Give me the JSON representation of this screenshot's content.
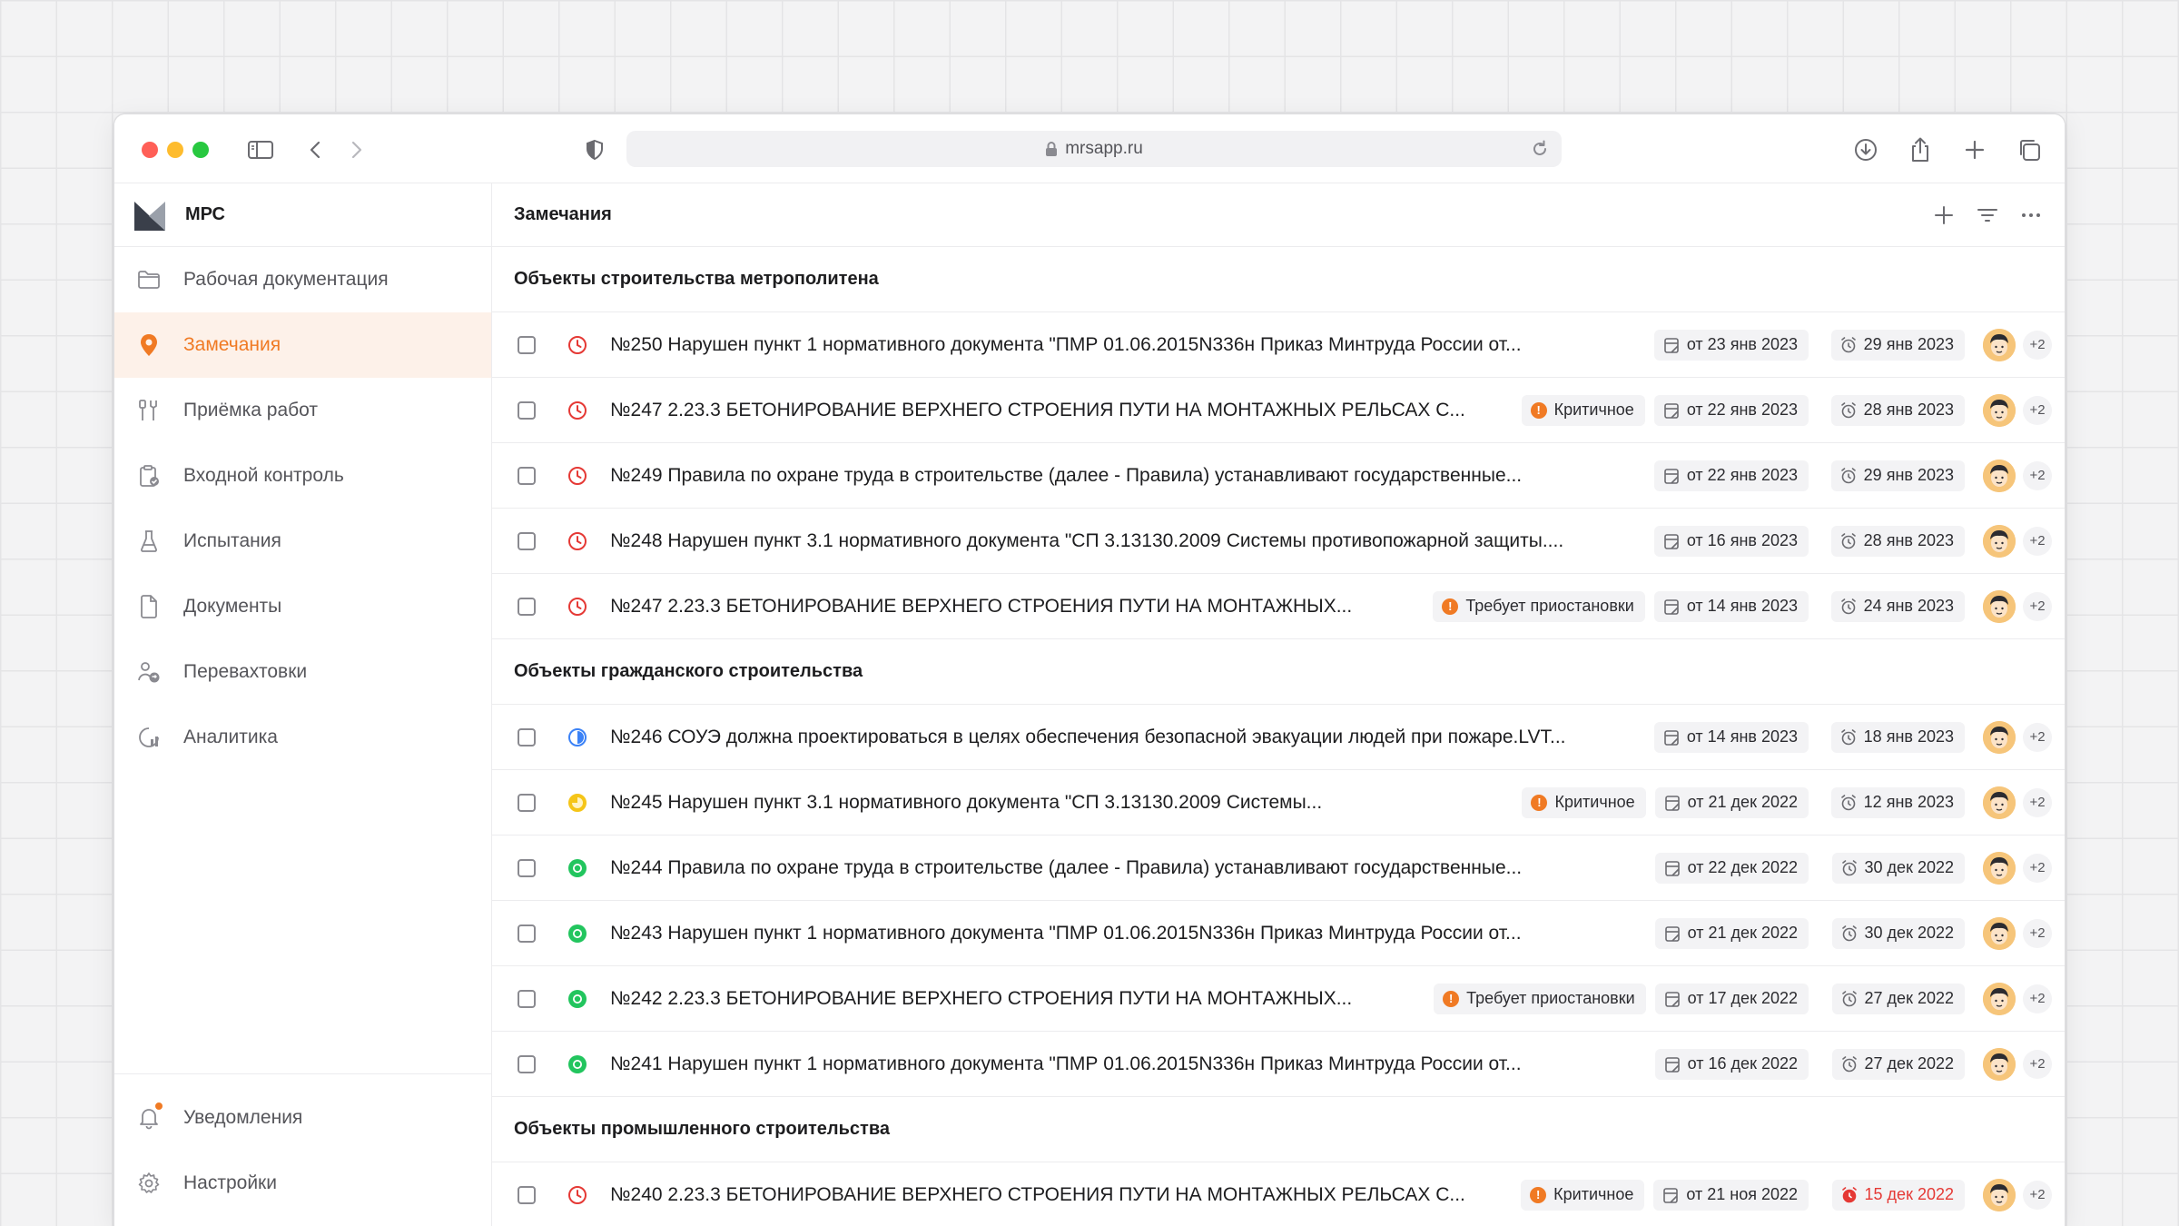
{
  "browser": {
    "url": "mrsapp.ru"
  },
  "app": {
    "name": "МРС"
  },
  "sidebar": {
    "items": [
      {
        "label": "Рабочая документация",
        "icon": "folder-icon"
      },
      {
        "label": "Замечания",
        "icon": "location-pin-icon",
        "active": true
      },
      {
        "label": "Приёмка работ",
        "icon": "tools-icon"
      },
      {
        "label": "Входной контроль",
        "icon": "clipboard-check-icon"
      },
      {
        "label": "Испытания",
        "icon": "flask-icon"
      },
      {
        "label": "Документы",
        "icon": "document-icon"
      },
      {
        "label": "Перевахтовки",
        "icon": "people-swap-icon"
      },
      {
        "label": "Аналитика",
        "icon": "analytics-icon"
      }
    ],
    "bottom": [
      {
        "label": "Уведомления",
        "icon": "bell-icon",
        "badge": true
      },
      {
        "label": "Настройки",
        "icon": "gear-icon"
      }
    ]
  },
  "main": {
    "title": "Замечания",
    "groups": [
      {
        "title": "Объекты строительства метрополитена",
        "rows": [
          {
            "text": "№250 Нарушен пункт 1 нормативного документа \"ПМР 01.06.2015N336н Приказ Минтруда России от...",
            "status": "red-clock",
            "tag": null,
            "from": "от 23 янв 2023",
            "due": "29 янв 2023",
            "overdue": false,
            "extra": "+2"
          },
          {
            "text": "№247 2.23.3 БЕТОНИРОВАНИЕ ВЕРХНЕГО СТРОЕНИЯ ПУТИ НА МОНТАЖНЫХ РЕЛЬСАХ С...",
            "status": "red-clock",
            "tag": "Критичное",
            "from": "от 22 янв 2023",
            "due": "28 янв 2023",
            "overdue": false,
            "extra": "+2"
          },
          {
            "text": "№249 Правила по охране труда в строительстве (далее - Правила) устанавливают государственные...",
            "status": "red-clock",
            "tag": null,
            "from": "от 22 янв 2023",
            "due": "29 янв 2023",
            "overdue": false,
            "extra": "+2"
          },
          {
            "text": "№248 Нарушен пункт 3.1 нормативного документа \"СП 3.13130.2009 Системы противопожарной защиты....",
            "status": "red-clock",
            "tag": null,
            "from": "от 16 янв 2023",
            "due": "28 янв 2023",
            "overdue": false,
            "extra": "+2"
          },
          {
            "text": "№247 2.23.3 БЕТОНИРОВАНИЕ ВЕРХНЕГО СТРОЕНИЯ ПУТИ НА МОНТАЖНЫХ...",
            "status": "red-clock",
            "tag": "Требует приостановки",
            "from": "от 14 янв 2023",
            "due": "24 янв 2023",
            "overdue": false,
            "extra": "+2"
          }
        ]
      },
      {
        "title": "Объекты гражданского строительства",
        "rows": [
          {
            "text": "№246 СОУЭ должна проектироваться в целях обеспечения безопасной эвакуации людей при пожаре.LVT...",
            "status": "blue-half",
            "tag": null,
            "from": "от 14 янв 2023",
            "due": "18 янв 2023",
            "overdue": false,
            "extra": "+2"
          },
          {
            "text": "№245 Нарушен пункт 3.1 нормативного документа \"СП 3.13130.2009 Системы...",
            "status": "yellow-partial",
            "tag": "Критичное",
            "from": "от 21 дек 2022",
            "due": "12 янв 2023",
            "overdue": false,
            "extra": "+2"
          },
          {
            "text": "№244 Правила по охране труда в строительстве (далее - Правила) устанавливают государственные...",
            "status": "green-done",
            "tag": null,
            "from": "от 22 дек 2022",
            "due": "30 дек 2022",
            "overdue": false,
            "extra": "+2"
          },
          {
            "text": "№243 Нарушен пункт 1 нормативного документа \"ПМР 01.06.2015N336н Приказ Минтруда России от...",
            "status": "green-done",
            "tag": null,
            "from": "от 21 дек 2022",
            "due": "30 дек 2022",
            "overdue": false,
            "extra": "+2"
          },
          {
            "text": "№242 2.23.3 БЕТОНИРОВАНИЕ ВЕРХНЕГО СТРОЕНИЯ ПУТИ НА МОНТАЖНЫХ...",
            "status": "green-done",
            "tag": "Требует приостановки",
            "from": "от 17 дек 2022",
            "due": "27 дек 2022",
            "overdue": false,
            "extra": "+2"
          },
          {
            "text": "№241 Нарушен пункт 1 нормативного документа \"ПМР 01.06.2015N336н Приказ Минтруда России от...",
            "status": "green-done",
            "tag": null,
            "from": "от 16 дек 2022",
            "due": "27 дек 2022",
            "overdue": false,
            "extra": "+2"
          }
        ]
      },
      {
        "title": "Объекты промышленного строительства",
        "rows": [
          {
            "text": "№240 2.23.3 БЕТОНИРОВАНИЕ ВЕРХНЕГО СТРОЕНИЯ ПУТИ НА МОНТАЖНЫХ РЕЛЬСАХ С...",
            "status": "red-clock",
            "tag": "Критичное",
            "from": "от 21 ноя 2022",
            "due": "15 дек 2022",
            "overdue": true,
            "extra": "+2"
          }
        ]
      }
    ]
  },
  "colors": {
    "accent": "#f07a24",
    "danger": "#e53935",
    "info": "#3b82f6",
    "warning": "#f5c518",
    "success": "#22c55e"
  }
}
